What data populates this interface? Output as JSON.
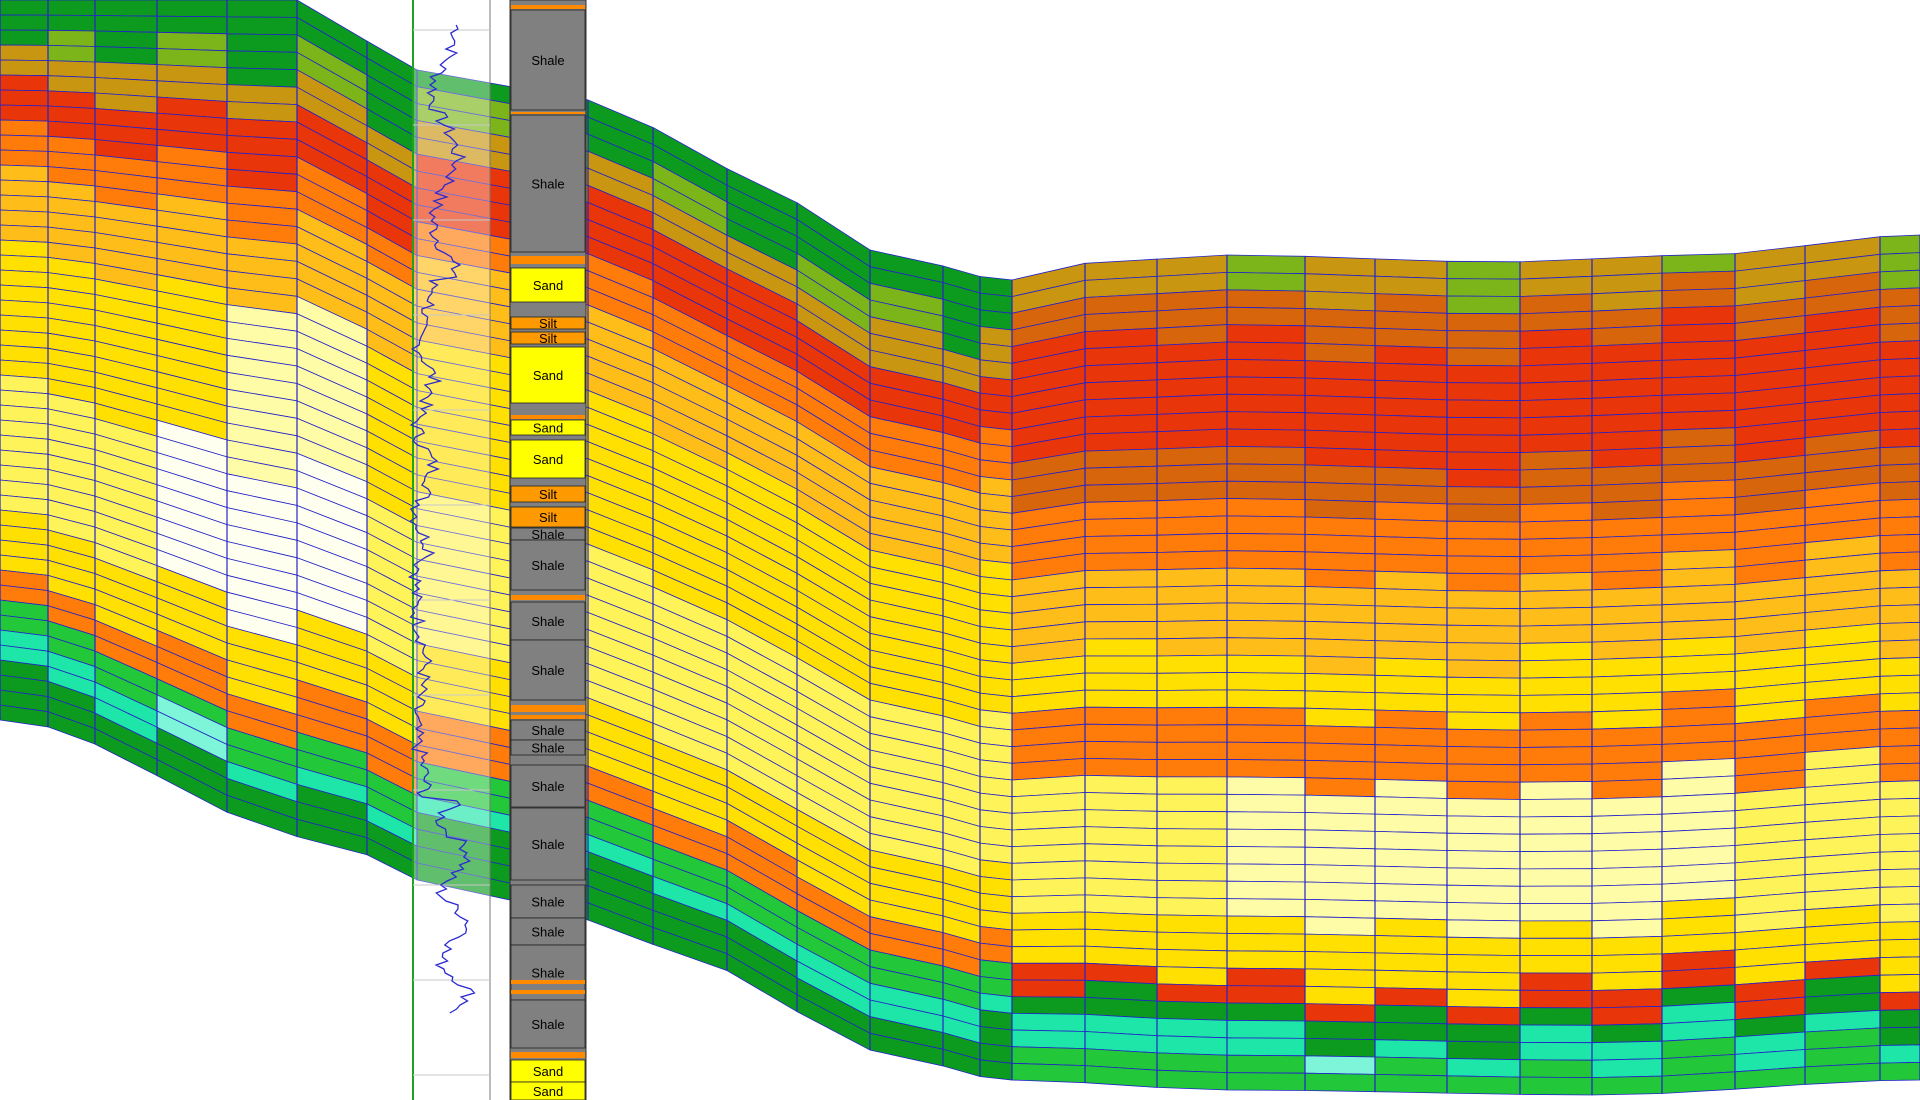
{
  "colors": {
    "background": "#ffffff",
    "grid_line": "#2323c8",
    "log_curve": "#2a2ad0",
    "well_track_border": "#1fa21f",
    "shale": "#808080",
    "sand": "#ffff00",
    "silt": "#ff9900",
    "thin_bed": "#ff8a00",
    "property_scale": [
      "#7ef5d8",
      "#1ee6a8",
      "#22c73a",
      "#0c9b1e",
      "#7cb51a",
      "#c99612",
      "#d7650c",
      "#e8350a",
      "#ff7c0a",
      "#ffbd1a",
      "#ffe000",
      "#fff35a",
      "#fffca8",
      "#fffff0"
    ]
  },
  "well": {
    "facies_column": [
      {
        "label": "Shale",
        "type": "shale"
      },
      {
        "label": "Shale",
        "type": "shale"
      },
      {
        "label": "Sand",
        "type": "sand"
      },
      {
        "label": "Silt",
        "type": "silt"
      },
      {
        "label": "Silt",
        "type": "silt"
      },
      {
        "label": "Sand",
        "type": "sand"
      },
      {
        "label": "Sand",
        "type": "sand"
      },
      {
        "label": "Sand",
        "type": "sand"
      },
      {
        "label": "Silt",
        "type": "silt"
      },
      {
        "label": "Silt",
        "type": "silt"
      },
      {
        "label": "Shale",
        "type": "shale"
      },
      {
        "label": "Shale",
        "type": "shale"
      },
      {
        "label": "Shale",
        "type": "shale"
      },
      {
        "label": "Shale",
        "type": "shale"
      },
      {
        "label": "Shale",
        "type": "shale"
      },
      {
        "label": "Shale",
        "type": "shale"
      },
      {
        "label": "Shale",
        "type": "shale"
      },
      {
        "label": "Shale",
        "type": "shale"
      },
      {
        "label": "Shale",
        "type": "shale"
      },
      {
        "label": "Shale",
        "type": "shale"
      },
      {
        "label": "Shale",
        "type": "shale"
      },
      {
        "label": "Shale",
        "type": "shale"
      },
      {
        "label": "Sand",
        "type": "sand"
      },
      {
        "label": "Sand",
        "type": "sand"
      }
    ]
  }
}
